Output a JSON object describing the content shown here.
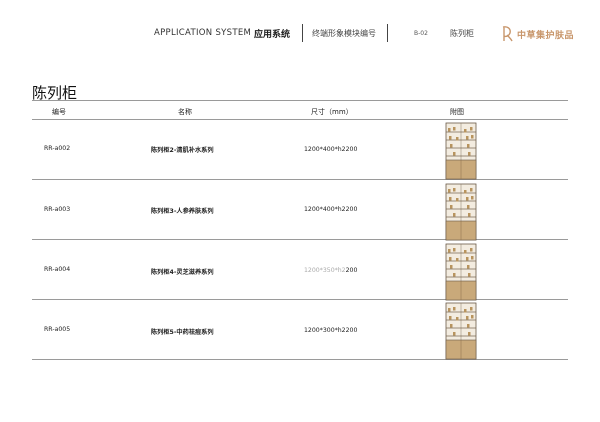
{
  "header": {
    "title": "APPLICATION SYSTEM",
    "title_cn": "应用系统",
    "subtitle": "终端形象模块编号",
    "code": "B-02",
    "category": "陈列柜",
    "logo_text": "中草集护肤品"
  },
  "page": {
    "title": "陈列柜"
  },
  "table": {
    "columns": [
      "编号",
      "名称",
      "尺寸（mm）",
      "附图"
    ],
    "rows": [
      {
        "code": "RR-a002",
        "name": "陈列柜2-清肌补水系列",
        "size": "1200*400*h2200",
        "image": "cabinet-thumbnail"
      },
      {
        "code": "RR-a003",
        "name": "陈列柜3-人参养肤系列",
        "size": "1200*400*h2200",
        "image": "cabinet-thumbnail"
      },
      {
        "code": "RR-a004",
        "name": "陈列柜4-灵芝滋养系列",
        "size_faint": "1200*350*h2",
        "size_tail": "200",
        "image": "cabinet-thumbnail"
      },
      {
        "code": "RR-a005",
        "name": "陈列柜5-中药祛痘系列",
        "size": "1200*300*h2200",
        "image": "cabinet-thumbnail"
      }
    ]
  },
  "colors": {
    "brand": "#c8966b",
    "rule": "#9a9a9a",
    "wood": "#c9a97a"
  }
}
